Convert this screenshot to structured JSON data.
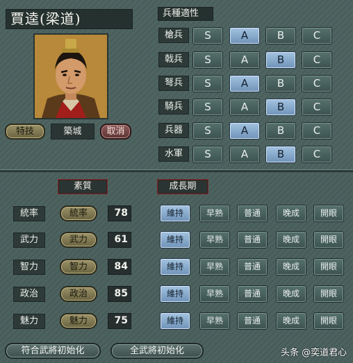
{
  "officer": {
    "name": "賈逵(梁道)",
    "city": "築城"
  },
  "buttons": {
    "skill": "特技",
    "cancel": "取消",
    "reset_matching": "符合武將初始化",
    "reset_all": "全武將初始化"
  },
  "troop_section": {
    "title": "兵種適性",
    "grades": [
      "S",
      "A",
      "B",
      "C"
    ],
    "rows": [
      {
        "label": "槍兵",
        "selected": "A"
      },
      {
        "label": "戟兵",
        "selected": "B"
      },
      {
        "label": "弩兵",
        "selected": "A"
      },
      {
        "label": "騎兵",
        "selected": "B"
      },
      {
        "label": "兵器",
        "selected": "A"
      },
      {
        "label": "水軍",
        "selected": "B"
      }
    ]
  },
  "stats_section": {
    "title": "素質",
    "growth_title": "成長期",
    "growth_options": [
      "維持",
      "早熟",
      "普通",
      "晚成",
      "開眼"
    ],
    "rows": [
      {
        "label": "統率",
        "pill": "統率",
        "value": "78",
        "growth": "維持"
      },
      {
        "label": "武力",
        "pill": "武力",
        "value": "61",
        "growth": "維持"
      },
      {
        "label": "智力",
        "pill": "智力",
        "value": "84",
        "growth": "維持"
      },
      {
        "label": "政治",
        "pill": "政治",
        "value": "85",
        "growth": "維持"
      },
      {
        "label": "魅力",
        "pill": "魅力",
        "value": "75",
        "growth": "維持"
      }
    ]
  },
  "watermark": "头条 @奕道君心",
  "colors": {
    "selected": "#8fb2d4",
    "panel": "#4a5f5c"
  }
}
